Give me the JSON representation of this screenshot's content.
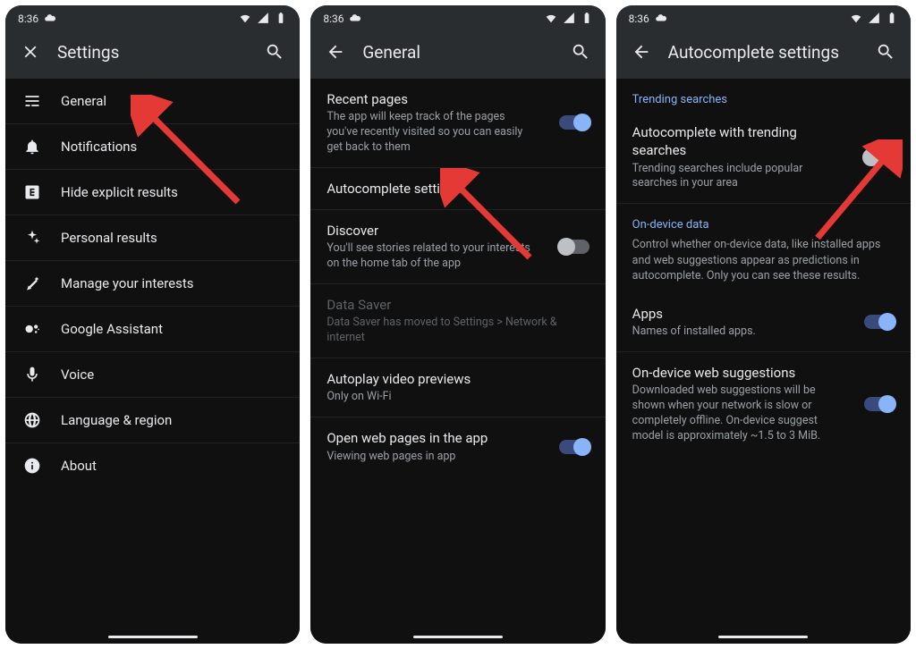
{
  "status": {
    "time": "8:36"
  },
  "colors": {
    "accent": "#8ab4f8",
    "bg": "#101010",
    "barbg": "#2a2d30",
    "subtext": "#9aa0a6",
    "arrow": "#e53935"
  },
  "screen1": {
    "title": "Settings",
    "items": [
      {
        "label": "General"
      },
      {
        "label": "Notifications"
      },
      {
        "label": "Hide explicit results"
      },
      {
        "label": "Personal results"
      },
      {
        "label": "Manage your interests"
      },
      {
        "label": "Google Assistant"
      },
      {
        "label": "Voice"
      },
      {
        "label": "Language & region"
      },
      {
        "label": "About"
      }
    ]
  },
  "screen2": {
    "title": "General",
    "items": [
      {
        "label": "Recent pages",
        "sub": "The app will keep track of the pages you've recently visited so you can easily get back to them",
        "toggle": "on"
      },
      {
        "label": "Autocomplete settings"
      },
      {
        "label": "Discover",
        "sub": "You'll see stories related to your interests on the home tab of the app",
        "toggle": "off"
      },
      {
        "label": "Data Saver",
        "sub": "Data Saver has moved to Settings > Network & internet",
        "disabled": true
      },
      {
        "label": "Autoplay video previews",
        "sub": "Only on Wi-Fi"
      },
      {
        "label": "Open web pages in the app",
        "sub": "Viewing web pages in app",
        "toggle": "on"
      }
    ]
  },
  "screen3": {
    "title": "Autocomplete settings",
    "section1": {
      "header": "Trending searches"
    },
    "item1": {
      "label": "Autocomplete with trending searches",
      "sub": "Trending searches include popular searches in your area",
      "toggle": "off"
    },
    "section2": {
      "header": "On-device data",
      "sub": "Control whether on-device data, like installed apps and web suggestions appear as predictions in autocomplete. Only you can see these results."
    },
    "item2": {
      "label": "Apps",
      "sub": "Names of installed apps.",
      "toggle": "on"
    },
    "item3": {
      "label": "On-device web suggestions",
      "sub": "Downloaded web suggestions will be shown when your network is slow or completely offline. On-device suggest model is approximately ~1.5 to 3 MiB.",
      "toggle": "on"
    }
  }
}
